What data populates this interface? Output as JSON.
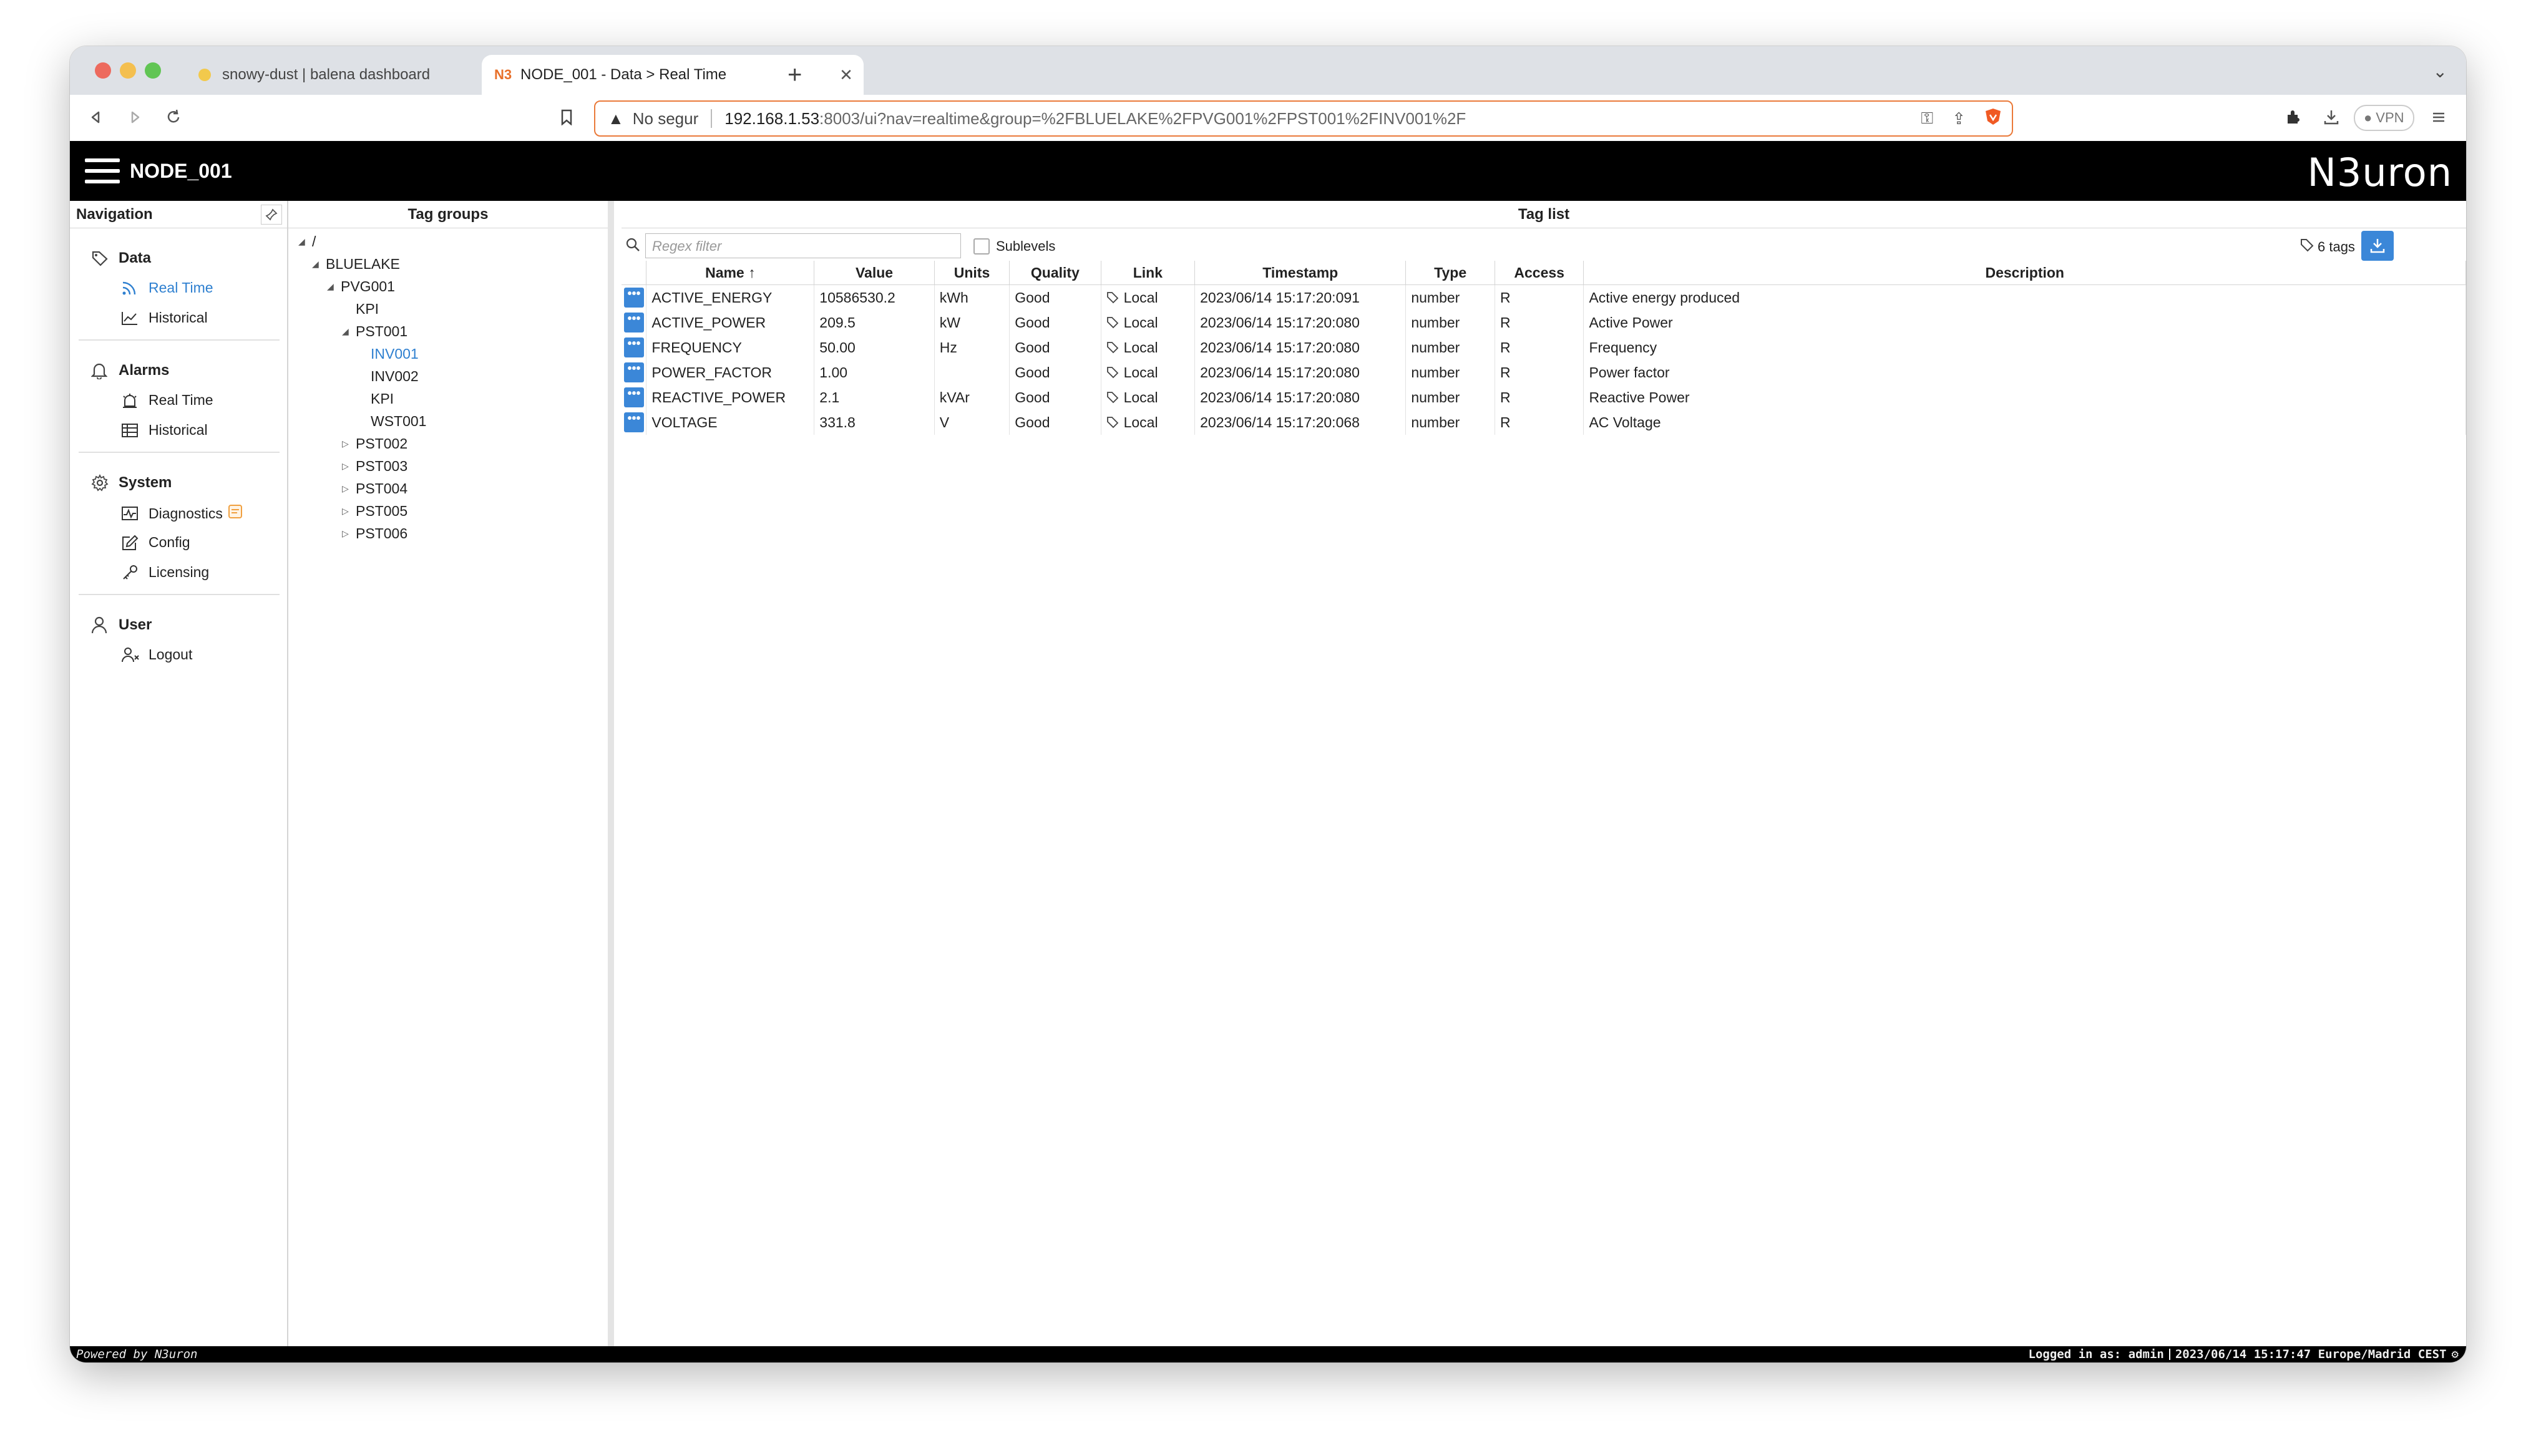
{
  "browser": {
    "tabs": [
      {
        "title": "snowy-dust | balena dashboard",
        "favicon": "balena-icon"
      },
      {
        "title": "NODE_001 - Data > Real Time",
        "favicon": "n3uron-icon"
      }
    ],
    "security_label": "No segur",
    "url_host": "192.168.1.53",
    "url_rest": ":8003/ui?nav=realtime&group=%2FBLUELAKE%2FPVG001%2FPST001%2FINV001%2F",
    "vpn_label": "VPN"
  },
  "app": {
    "title": "NODE_001",
    "logo": "N3uron"
  },
  "nav": {
    "header": "Navigation",
    "groups": [
      {
        "label": "Data",
        "icon": "tag-icon",
        "items": [
          {
            "label": "Real Time",
            "icon": "feed-icon",
            "selected": true
          },
          {
            "label": "Historical",
            "icon": "line-chart-icon"
          }
        ]
      },
      {
        "label": "Alarms",
        "icon": "bell-icon",
        "items": [
          {
            "label": "Real Time",
            "icon": "alarm-realtime-icon"
          },
          {
            "label": "Historical",
            "icon": "table-icon"
          }
        ]
      },
      {
        "label": "System",
        "icon": "gear-icon",
        "items": [
          {
            "label": "Diagnostics",
            "icon": "diagnostics-icon"
          },
          {
            "label": "Config",
            "icon": "edit-icon"
          },
          {
            "label": "Licensing",
            "icon": "key-icon"
          }
        ]
      },
      {
        "label": "User",
        "icon": "user-icon",
        "items": [
          {
            "label": "Logout",
            "icon": "logout-icon"
          }
        ]
      }
    ]
  },
  "tag_groups": {
    "header": "Tag groups",
    "tree": [
      {
        "label": "/",
        "state": "open"
      },
      {
        "label": "BLUELAKE",
        "state": "open"
      },
      {
        "label": "PVG001",
        "state": "open"
      },
      {
        "label": "KPI",
        "state": "leaf"
      },
      {
        "label": "PST001",
        "state": "open"
      },
      {
        "label": "INV001",
        "state": "leaf",
        "selected": true
      },
      {
        "label": "INV002",
        "state": "leaf"
      },
      {
        "label": "KPI",
        "state": "leaf"
      },
      {
        "label": "WST001",
        "state": "leaf"
      },
      {
        "label": "PST002",
        "state": "closed"
      },
      {
        "label": "PST003",
        "state": "closed"
      },
      {
        "label": "PST004",
        "state": "closed"
      },
      {
        "label": "PST005",
        "state": "closed"
      },
      {
        "label": "PST006",
        "state": "closed"
      }
    ]
  },
  "tag_list": {
    "header": "Tag list",
    "filter_placeholder": "Regex filter",
    "sublevels_label": "Sublevels",
    "tag_count": "6 tags",
    "columns": [
      "Name",
      "Value",
      "Units",
      "Quality",
      "Link",
      "Timestamp",
      "Type",
      "Access",
      "Description"
    ],
    "sort_indicator": "↑",
    "rows": [
      {
        "name": "ACTIVE_ENERGY",
        "value": "10586530.2",
        "units": "kWh",
        "quality": "Good",
        "link": "Local",
        "timestamp": "2023/06/14 15:17:20:091",
        "type": "number",
        "access": "R",
        "description": "Active energy produced"
      },
      {
        "name": "ACTIVE_POWER",
        "value": "209.5",
        "units": "kW",
        "quality": "Good",
        "link": "Local",
        "timestamp": "2023/06/14 15:17:20:080",
        "type": "number",
        "access": "R",
        "description": "Active Power"
      },
      {
        "name": "FREQUENCY",
        "value": "50.00",
        "units": "Hz",
        "quality": "Good",
        "link": "Local",
        "timestamp": "2023/06/14 15:17:20:080",
        "type": "number",
        "access": "R",
        "description": "Frequency"
      },
      {
        "name": "POWER_FACTOR",
        "value": "1.00",
        "units": "",
        "quality": "Good",
        "link": "Local",
        "timestamp": "2023/06/14 15:17:20:080",
        "type": "number",
        "access": "R",
        "description": "Power factor"
      },
      {
        "name": "REACTIVE_POWER",
        "value": "2.1",
        "units": "kVAr",
        "quality": "Good",
        "link": "Local",
        "timestamp": "2023/06/14 15:17:20:080",
        "type": "number",
        "access": "R",
        "description": "Reactive Power"
      },
      {
        "name": "VOLTAGE",
        "value": "331.8",
        "units": "V",
        "quality": "Good",
        "link": "Local",
        "timestamp": "2023/06/14 15:17:20:068",
        "type": "number",
        "access": "R",
        "description": "AC Voltage"
      }
    ]
  },
  "status_bar": {
    "left": "Powered by N3uron",
    "user": "Logged in as: admin",
    "datetime": "2023/06/14 15:17:47 Europe/Madrid CEST"
  },
  "colors": {
    "accent": "#3b87d8",
    "selected_text": "#2f80d0",
    "header_bg": "#000000"
  }
}
